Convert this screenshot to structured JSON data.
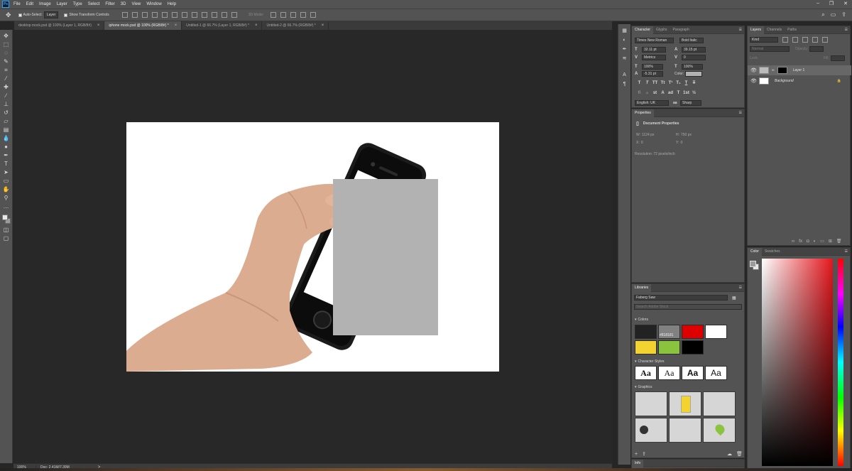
{
  "app": {
    "logo": "Ps"
  },
  "menu": [
    "File",
    "Edit",
    "Image",
    "Layer",
    "Type",
    "Select",
    "Filter",
    "3D",
    "View",
    "Window",
    "Help"
  ],
  "window_controls": {
    "minimize": "–",
    "restore": "❐",
    "close": "✕"
  },
  "options_bar": {
    "auto_select_label": "Auto-Select:",
    "auto_select_value": "Layer",
    "show_transform_label": "Show Transform Controls",
    "mode_3d_label": "3D Mode:"
  },
  "tabs": [
    {
      "label": "desktop mock.psd @ 100% (Layer 1, RGB/8#)",
      "active": false
    },
    {
      "label": "iphone mock.psd @ 100% (RGB/8#) *",
      "active": true
    },
    {
      "label": "Untitled-1 @ 66.7% (Layer 1, RGB/8#) *",
      "active": false
    },
    {
      "label": "Untitled-2 @ 66.7% (RGB/8#) *",
      "active": false
    }
  ],
  "status": {
    "zoom": "100%",
    "doc": "Doc: 2.41M/7.39M",
    "arrow": ">"
  },
  "character": {
    "tabs": [
      "Character",
      "Glyphs",
      "Paragraph"
    ],
    "font_family": "Times New Roman",
    "font_style": "Bold Italic",
    "font_size": "32.11 pt",
    "leading": "39.15 pt",
    "kerning": "Metrics",
    "tracking": "0",
    "vertical_scale": "100%",
    "horizontal_scale": "100%",
    "baseline_shift": "-5.31 pt",
    "color_label": "Color:",
    "type_buttons": [
      "T",
      "T",
      "TT",
      "Tt",
      "T¹",
      "T₁",
      "T",
      "T"
    ],
    "ot_buttons": [
      "fi",
      "ℴ",
      "st",
      "A",
      "ad",
      "T",
      "1st",
      "½"
    ],
    "language": "English: UK",
    "antialias": "Sharp"
  },
  "properties": {
    "title": "Properties",
    "section": "Document Properties",
    "w_label": "W:",
    "w": "1124 px",
    "h_label": "H:",
    "h": "750 px",
    "x_label": "X:",
    "x": "0",
    "y_label": "Y:",
    "y": "0",
    "resolution": "Resolution: 72 pixels/inch"
  },
  "libraries": {
    "title": "Libraries",
    "library_name": "Faberg Saw",
    "search_placeholder": "Search Adobe Stock",
    "colors_header": "Colors",
    "colors": [
      "#222222",
      "#818181",
      "#dd0000",
      "#ffffff",
      "#f3d330",
      "#8ac43f",
      "#000000"
    ],
    "swatch_label": "#818181",
    "char_styles_header": "Character Styles",
    "char_styles": [
      "Aa",
      "Aa",
      "Aa",
      "Aa"
    ],
    "graphics_header": "Graphics"
  },
  "info": {
    "title": "Info"
  },
  "layers": {
    "tabs": [
      "Layers",
      "Channels",
      "Paths"
    ],
    "kind": "Kind",
    "blend": "Normal",
    "opacity_label": "Opacity:",
    "lock_label": "Lock:",
    "fill_label": "Fill:",
    "items": [
      {
        "name": "Layer 1",
        "selected": true
      },
      {
        "name": "Background",
        "selected": false
      }
    ]
  },
  "color_panel": {
    "tabs": [
      "Color",
      "Swatches"
    ]
  }
}
